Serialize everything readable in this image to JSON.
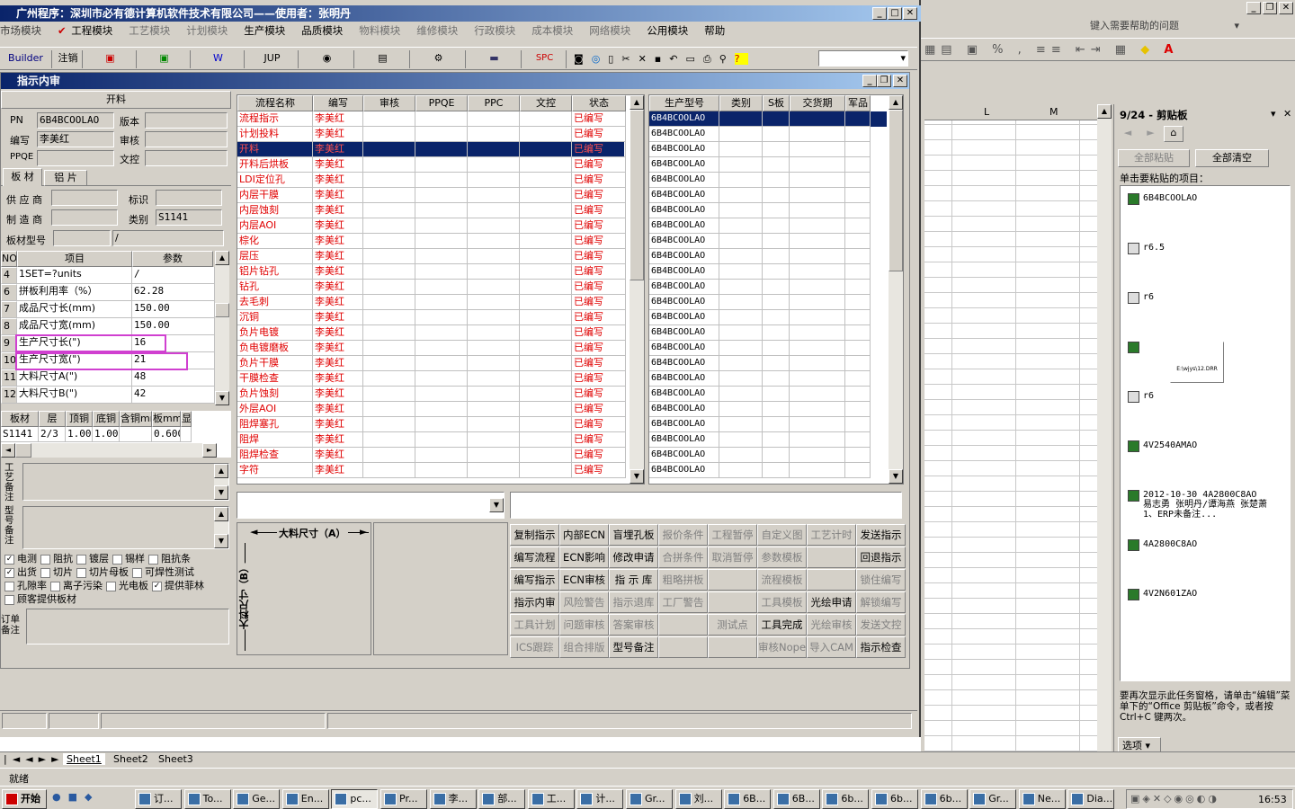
{
  "app": {
    "title": "广州程序：深圳市必有德计算机软件技术有限公司——使用者：张明丹"
  },
  "menu": [
    "市场模块",
    "工程模块",
    "工艺模块",
    "计划模块",
    "生产模块",
    "品质模块",
    "物料模块",
    "维修模块",
    "行政模块",
    "成本模块",
    "网络模块",
    "公用模块",
    "帮助"
  ],
  "toolbar": {
    "builder": "Builder",
    "logout": "注销",
    "jup": "JUP",
    "spc": "SPC"
  },
  "inner": {
    "title": "指示内审"
  },
  "left": {
    "header": "开料",
    "pn_label": "PN",
    "pn": "6B4BCOOLAO",
    "version_label": "版本",
    "writer_label": "编写",
    "writer": "李美红",
    "review_label": "审核",
    "ppqe_label": "PPQE",
    "doc_label": "文控",
    "tab1": "板 材",
    "tab2": "铝 片",
    "supplier_label": "供 应 商",
    "mark_label": "标识",
    "maker_label": "制 造 商",
    "type_label": "类别",
    "type": "S1141",
    "model_label": "板材型号",
    "model": "/",
    "params_head": [
      "NO",
      "项目",
      "参数"
    ],
    "params": [
      {
        "no": "4",
        "item": "1SET=?units",
        "val": "/"
      },
      {
        "no": "6",
        "item": "拼板利用率（%）",
        "val": "62.28"
      },
      {
        "no": "7",
        "item": "成品尺寸长(mm)",
        "val": "150.00"
      },
      {
        "no": "8",
        "item": "成品尺寸宽(mm)",
        "val": "150.00"
      },
      {
        "no": "9",
        "item": "生产尺寸长(\")",
        "val": "16"
      },
      {
        "no": "10",
        "item": "生产尺寸宽(\")",
        "val": "21"
      },
      {
        "no": "11",
        "item": "大料尺寸A(\")",
        "val": "48"
      },
      {
        "no": "12",
        "item": "大料尺寸B(\")",
        "val": "42"
      }
    ],
    "mat_head": [
      "板材",
      "层",
      "顶铜",
      "底铜",
      "含铜mm",
      "板mm",
      "显"
    ],
    "mat_row": [
      "S1141",
      "2/3",
      "1.00",
      "1.00",
      "",
      "0.600",
      ""
    ],
    "note1": "工艺备注",
    "note2": "型号备注",
    "checks": [
      {
        "label": "电测",
        "on": true
      },
      {
        "label": "阻抗",
        "on": false
      },
      {
        "label": "镀层",
        "on": false
      },
      {
        "label": "锡样",
        "on": false
      },
      {
        "label": "阻抗条",
        "on": false
      },
      {
        "label": "出货",
        "on": true
      },
      {
        "label": "切片",
        "on": false
      },
      {
        "label": "切片母板",
        "on": false
      },
      {
        "label": "可焊性测试",
        "on": false
      },
      {
        "label": "孔隙率",
        "on": false
      },
      {
        "label": "离子污染",
        "on": false
      },
      {
        "label": "光电板",
        "on": false
      },
      {
        "label": "提供菲林",
        "on": true
      },
      {
        "label": "顾客提供板材",
        "on": false
      }
    ],
    "order_note": "订单备注"
  },
  "flow": {
    "head": [
      "流程名称",
      "编写",
      "审核",
      "PPQE",
      "PPC",
      "文控",
      "状态"
    ],
    "rows": [
      [
        "流程指示",
        "李美红",
        "已编写"
      ],
      [
        "计划投料",
        "李美红",
        "已编写"
      ],
      [
        "开料",
        "李美红",
        "已编写"
      ],
      [
        "开料后烘板",
        "李美红",
        "已编写"
      ],
      [
        "LDI定位孔",
        "李美红",
        "已编写"
      ],
      [
        "内层干膜",
        "李美红",
        "已编写"
      ],
      [
        "内层蚀刻",
        "李美红",
        "已编写"
      ],
      [
        "内层AOI",
        "李美红",
        "已编写"
      ],
      [
        "棕化",
        "李美红",
        "已编写"
      ],
      [
        "层压",
        "李美红",
        "已编写"
      ],
      [
        "铝片钻孔",
        "李美红",
        "已编写"
      ],
      [
        "钻孔",
        "李美红",
        "已编写"
      ],
      [
        "去毛刺",
        "李美红",
        "已编写"
      ],
      [
        "沉铜",
        "李美红",
        "已编写"
      ],
      [
        "负片电镀",
        "李美红",
        "已编写"
      ],
      [
        "负电镀磨板",
        "李美红",
        "已编写"
      ],
      [
        "负片干膜",
        "李美红",
        "已编写"
      ],
      [
        "干膜检查",
        "李美红",
        "已编写"
      ],
      [
        "负片蚀刻",
        "李美红",
        "已编写"
      ],
      [
        "外层AOI",
        "李美红",
        "已编写"
      ],
      [
        "阻焊塞孔",
        "李美红",
        "已编写"
      ],
      [
        "阻焊",
        "李美红",
        "已编写"
      ],
      [
        "阻焊检查",
        "李美红",
        "已编写"
      ],
      [
        "字符",
        "李美红",
        "已编写"
      ]
    ]
  },
  "models": {
    "head": [
      "生产型号",
      "类别",
      "S板",
      "交货期",
      "军品"
    ],
    "rows": [
      "6B4BCOOLAO",
      "6B4BCOOLAO",
      "6B4BCOOLAO",
      "6B4BCOOLAO",
      "6B4BCOOLAO",
      "6B4BCOOLAO",
      "6B4BCOOLAO",
      "6B4BCOOLAO",
      "6B4BCOOLAO",
      "6B4BCOOLAO",
      "6B4BCOOLAO",
      "6B4BCOOLAO",
      "6B4BCOOLAO",
      "6B4BCOOLAO",
      "6B4BCOOLAO",
      "6B4BCOOLAO",
      "6B4BCOOLAO",
      "6B4BCOOLAO",
      "6B4BCOOLAO",
      "6B4BCOOLAO",
      "6B4BCOOLAO",
      "6B4BCOOLAO",
      "6B4BCOOLAO",
      "6B4BCOOLAO"
    ]
  },
  "dims": {
    "a": "大料尺寸（A）",
    "b": "大料尺寸（B）"
  },
  "actions": [
    [
      "复制指示",
      "内部ECN",
      "盲埋孔板",
      "报价条件",
      "工程暂停",
      "自定义图",
      "工艺计时",
      "发送指示"
    ],
    [
      "编写流程",
      "ECN影响",
      "修改申请",
      "合拼条件",
      "取消暂停",
      "参数模板",
      "",
      "回退指示"
    ],
    [
      "编写指示",
      "ECN审核",
      "指 示 库",
      "粗略拼板",
      "",
      "流程模板",
      "",
      "锁住编写"
    ],
    [
      "指示内审",
      "风险警告",
      "指示退库",
      "工厂警告",
      "",
      "工具模板",
      "光绘申请",
      "解锁编写"
    ],
    [
      "工具计划",
      "问题审核",
      "答案审核",
      "",
      "测试点",
      "工具完成",
      "光绘审核",
      "发送文控"
    ],
    [
      "ICS跟踪",
      "组合排版",
      "型号备注",
      "",
      "",
      "审核Nope",
      "导入CAM",
      "指示检查"
    ]
  ],
  "actions_disabled": [
    [
      false,
      false,
      false,
      true,
      true,
      true,
      true,
      false
    ],
    [
      false,
      false,
      false,
      true,
      true,
      true,
      true,
      false
    ],
    [
      false,
      false,
      false,
      true,
      true,
      true,
      true,
      true
    ],
    [
      false,
      true,
      true,
      true,
      true,
      true,
      false,
      true
    ],
    [
      true,
      true,
      true,
      true,
      true,
      false,
      true,
      true
    ],
    [
      true,
      true,
      false,
      true,
      true,
      true,
      true,
      false
    ]
  ],
  "excel": {
    "help_placeholder": "键入需要帮助的问题",
    "col_l": "L",
    "col_m": "M",
    "sheets": [
      "Sheet1",
      "Sheet2",
      "Sheet3"
    ],
    "status": "就绪",
    "percent": "%"
  },
  "clipboard": {
    "title": "9/24 - 剪贴板",
    "paste_all": "全部粘贴",
    "clear_all": "全部清空",
    "prompt": "单击要粘贴的项目：",
    "items": [
      "6B4BCOOLAO",
      "r6.5",
      "r6",
      "",
      "r6",
      "4V2540AMAO",
      "2012-10-30 4A2800C8AO 易志勇 张明丹/谭海燕 张楚萧 1、ERP未备注...",
      "4A2800C8AO",
      "4V2N601ZAO"
    ],
    "file_icon_label": "E:\\wjys\\12.DRR",
    "footer": "要再次显示此任务窗格，请单击“编辑”菜单下的“Office 剪贴板”命令，或者按 Ctrl+C 键两次。",
    "options": "选项"
  },
  "taskbar": {
    "start": "开始",
    "tasks": [
      "订...",
      "To...",
      "Ge...",
      "En...",
      "pc...",
      "Pr...",
      "李...",
      "部...",
      "工...",
      "计...",
      "Gr...",
      "刘...",
      "6B...",
      "6B...",
      "6b...",
      "6b...",
      "6b...",
      "Gr...",
      "Ne...",
      "Dia..."
    ],
    "clock": "16:53"
  }
}
